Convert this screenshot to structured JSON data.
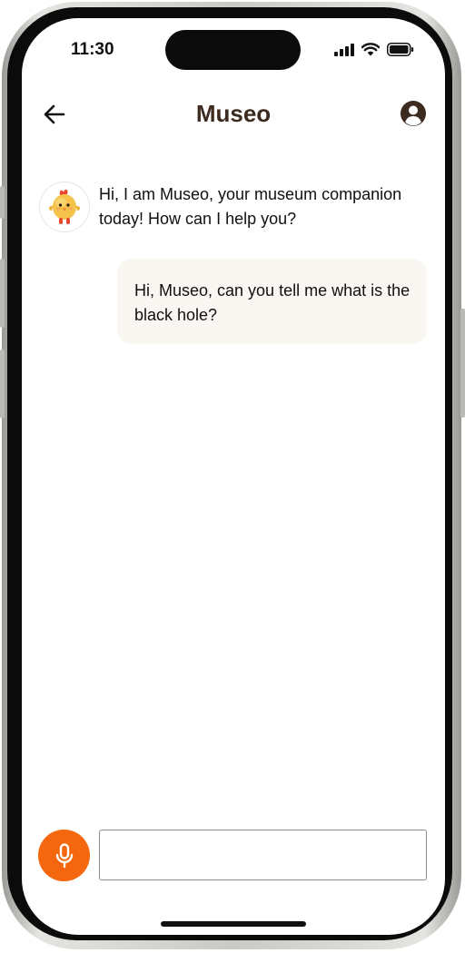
{
  "status_bar": {
    "time": "11:30",
    "icons": [
      "signal-icon",
      "wifi-icon",
      "battery-icon"
    ]
  },
  "header": {
    "title": "Museo",
    "back_icon": "arrow-left-icon",
    "profile_icon": "user-circle-icon"
  },
  "chat": {
    "messages": [
      {
        "sender": "bot",
        "avatar": "chick-mascot-icon",
        "text": "Hi, I am Museo, your museum companion today! How can I help you?"
      },
      {
        "sender": "user",
        "text": "Hi, Museo, can you tell me what is the black hole?"
      }
    ]
  },
  "composer": {
    "mic_icon": "microphone-icon",
    "input_value": "",
    "input_placeholder": ""
  },
  "colors": {
    "accent": "#f4670f",
    "title": "#3d2b20",
    "user_bubble": "#faf6f2"
  }
}
